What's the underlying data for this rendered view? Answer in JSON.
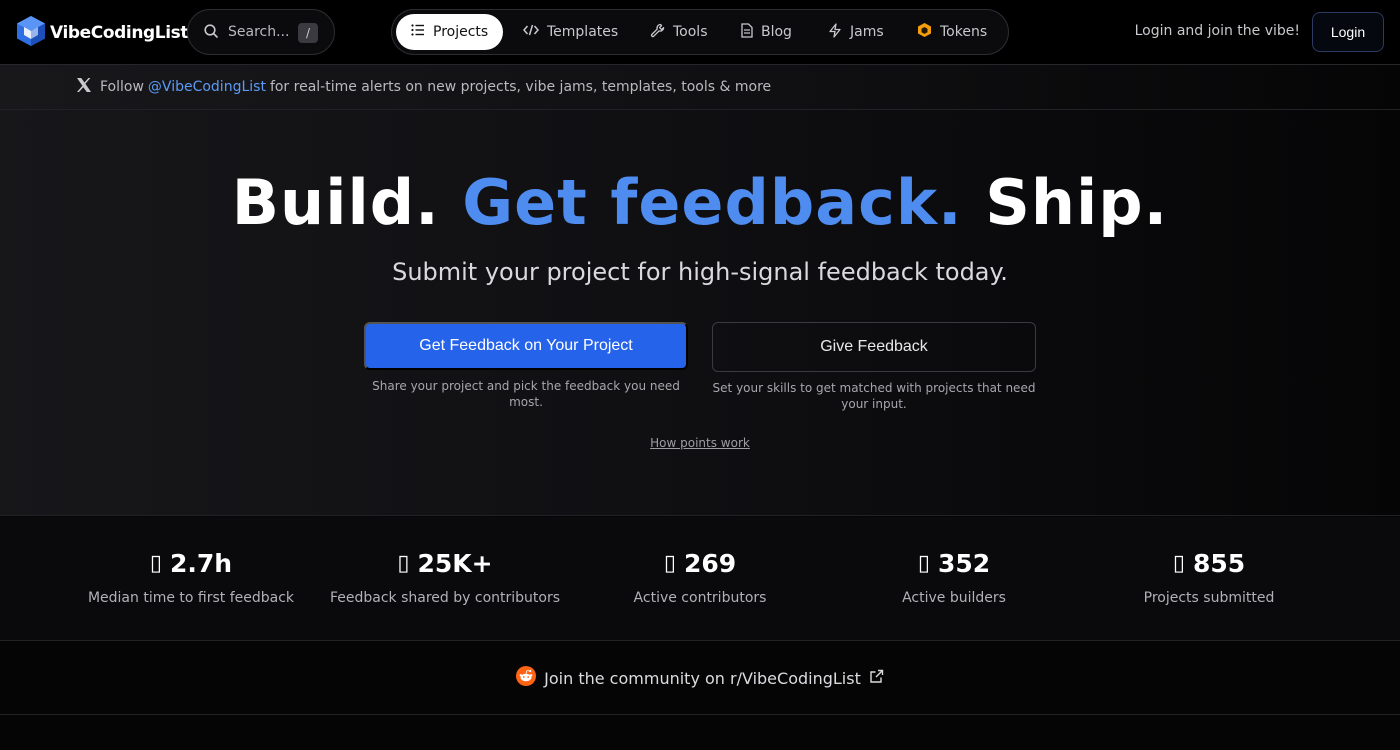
{
  "app": {
    "brand": "VibeCodingList",
    "search_placeholder": "Search...",
    "search_shortcut": "/"
  },
  "nav": {
    "items": [
      {
        "label": "Projects",
        "icon": "list-icon",
        "active": true
      },
      {
        "label": "Templates",
        "icon": "code-icon",
        "active": false
      },
      {
        "label": "Tools",
        "icon": "wrench-icon",
        "active": false
      },
      {
        "label": "Blog",
        "icon": "document-icon",
        "active": false
      },
      {
        "label": "Jams",
        "icon": "lightning-icon",
        "active": false
      },
      {
        "label": "Tokens",
        "icon": "hexagon-token-icon",
        "active": false
      }
    ]
  },
  "auth": {
    "prompt": "Login and join the vibe!",
    "login_label": "Login"
  },
  "banner": {
    "prefix": "Follow",
    "handle": "@VibeCodingList",
    "suffix": "for real-time alerts on new projects, vibe jams, templates, tools & more"
  },
  "hero": {
    "title_part1": "Build.",
    "title_accent": "Get feedback.",
    "title_part2": "Ship.",
    "subtitle": "Submit your project for high-signal feedback today.",
    "primary_cta": "Get Feedback on Your Project",
    "primary_help": "Share your project and pick the feedback you need most.",
    "secondary_cta": "Give Feedback",
    "secondary_help": "Set your skills to get matched with projects that need your input.",
    "points_link": "How points work"
  },
  "stats": [
    {
      "value": "2.7h",
      "label": "Median time to first feedback"
    },
    {
      "value": "25K+",
      "label": "Feedback shared by contributors"
    },
    {
      "value": "269",
      "label": "Active contributors"
    },
    {
      "value": "352",
      "label": "Active builders"
    },
    {
      "value": "855",
      "label": "Projects submitted"
    }
  ],
  "community": {
    "label": "Join the community on r/VibeCodingList"
  },
  "colors": {
    "accent": "#4f8cf0",
    "primary_button": "#2563eb",
    "reddit": "#ff6314",
    "token": "#f59e0b"
  }
}
